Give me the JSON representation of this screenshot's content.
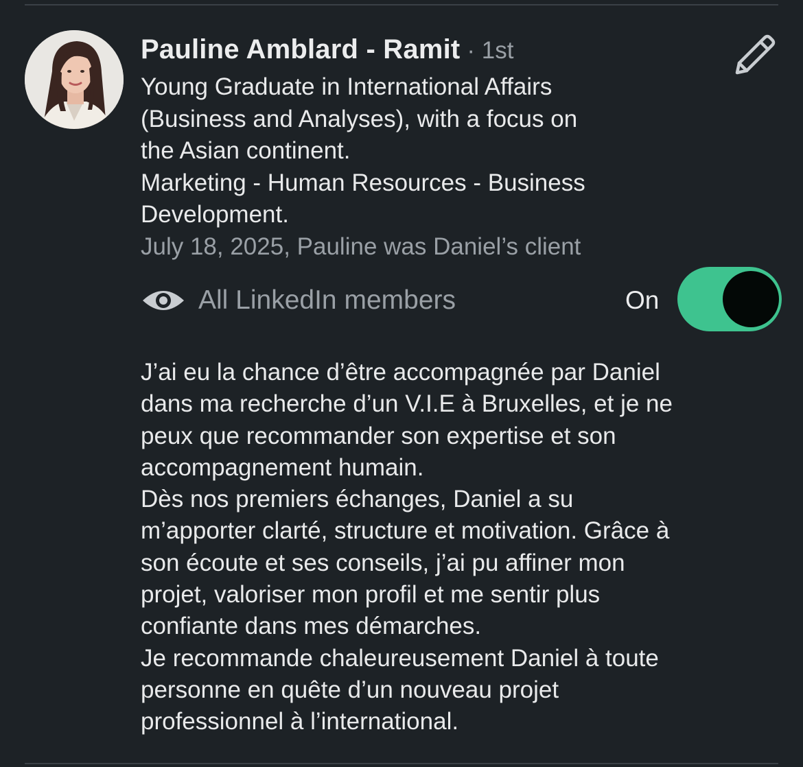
{
  "recommendation": {
    "author_name": "Pauline Amblard - Ramit",
    "connection_degree": "· 1st",
    "headline": "Young Graduate in International Affairs\n(Business and Analyses), with a focus on\nthe Asian continent.\nMarketing - Human Resources - Business\nDevelopment.",
    "date_relationship": "July 18, 2025, Pauline was Daniel’s client",
    "edit_icon": "pencil-icon",
    "visibility": {
      "icon": "eye-icon",
      "label": "All LinkedIn members",
      "toggle_label": "On",
      "toggle_on": true
    },
    "text": "J’ai eu la chance d’être accompagnée par Daniel\ndans ma recherche d’un V.I.E à Bruxelles, et je ne\npeux que recommander son expertise et son\naccompagnement humain.\nDès nos premiers échanges, Daniel a su\nm’apporter clarté, structure et motivation. Grâce à\nson écoute et ses conseils, j’ai pu affiner mon\nprojet, valoriser mon profil et me sentir plus\nconfiante dans mes démarches.\nJe recommande chaleureusement Daniel à toute\npersonne en quête d’un nouveau projet\nprofessionnel à l’international."
  },
  "colors": {
    "background": "#1d2226",
    "toggle_track": "#3ec38f",
    "toggle_knob": "#030806",
    "secondary_text": "#9aa0a6"
  }
}
